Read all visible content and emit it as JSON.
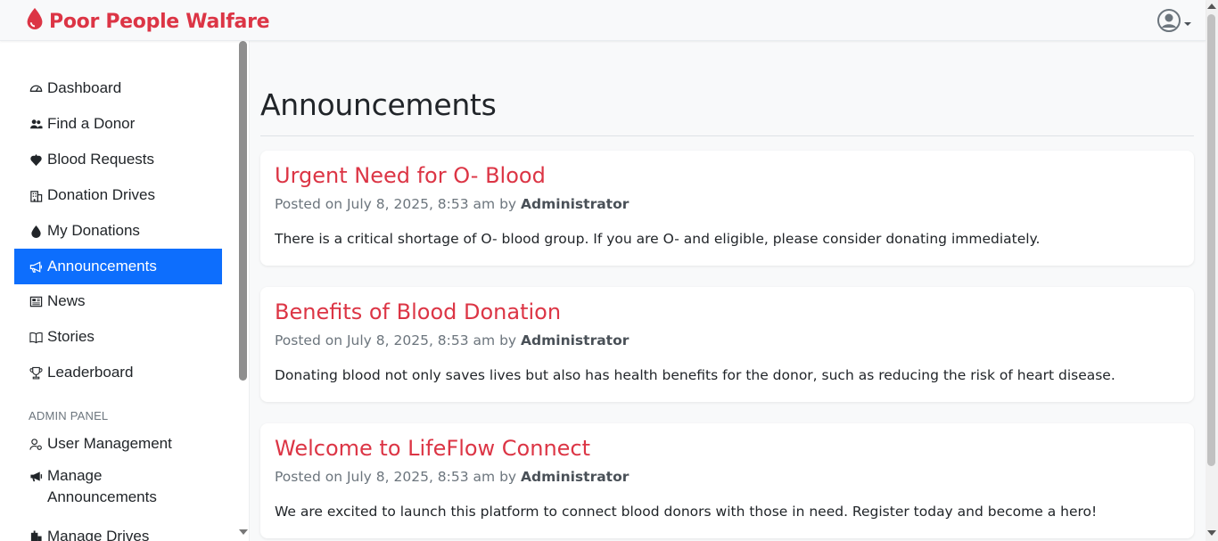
{
  "app": {
    "brand": "Poor People Walfare"
  },
  "colors": {
    "brand": "#dc3545",
    "active": "#0d6efd"
  },
  "sidebar": {
    "items": [
      {
        "label": "Dashboard",
        "icon": "speedometer-icon"
      },
      {
        "label": "Find a Donor",
        "icon": "people-icon"
      },
      {
        "label": "Blood Requests",
        "icon": "heart-drop-icon"
      },
      {
        "label": "Donation Drives",
        "icon": "building-icon"
      },
      {
        "label": "My Donations",
        "icon": "droplet-icon"
      },
      {
        "label": "Announcements",
        "icon": "megaphone-icon",
        "active": true
      },
      {
        "label": "News",
        "icon": "newspaper-icon"
      },
      {
        "label": "Stories",
        "icon": "book-icon"
      },
      {
        "label": "Leaderboard",
        "icon": "trophy-icon"
      }
    ],
    "admin_label": "ADMIN PANEL",
    "admin_items": [
      {
        "label": "User Management",
        "icon": "person-gear-icon"
      },
      {
        "label": "Manage Announcements",
        "icon": "megaphone-fill-icon"
      },
      {
        "label": "Manage Drives",
        "icon": "building-fill-icon"
      }
    ]
  },
  "main": {
    "title": "Announcements",
    "posted_prefix": "Posted on",
    "by_word": "by",
    "announcements": [
      {
        "title": "Urgent Need for O- Blood",
        "date": "July 8, 2025, 8:53 am",
        "author": "Administrator",
        "body": "There is a critical shortage of O- blood group. If you are O- and eligible, please consider donating immediately."
      },
      {
        "title": "Benefits of Blood Donation",
        "date": "July 8, 2025, 8:53 am",
        "author": "Administrator",
        "body": "Donating blood not only saves lives but also has health benefits for the donor, such as reducing the risk of heart disease."
      },
      {
        "title": "Welcome to LifeFlow Connect",
        "date": "July 8, 2025, 8:53 am",
        "author": "Administrator",
        "body": "We are excited to launch this platform to connect blood donors with those in need. Register today and become a hero!"
      }
    ]
  }
}
